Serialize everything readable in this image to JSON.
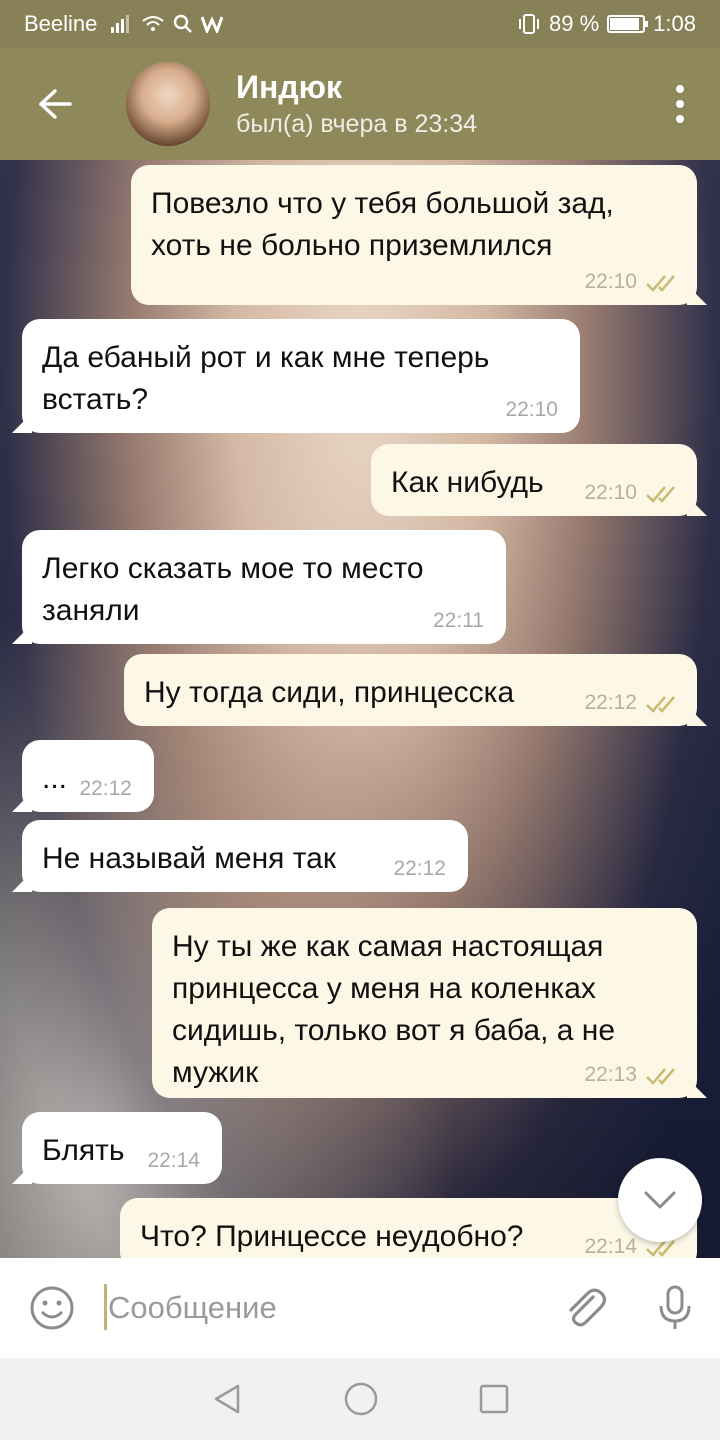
{
  "status": {
    "carrier": "Beeline",
    "battery": "89 %",
    "battery_level": 0.89,
    "time": "1:08"
  },
  "header": {
    "title": "Индюк",
    "subtitle": "был(а) вчера в 23:34"
  },
  "messages": [
    {
      "dir": "out",
      "text": "Повезло что у тебя большой зад, хоть не больно приземлился",
      "time": "22:10"
    },
    {
      "dir": "in",
      "text": "Да ебаный рот и как мне теперь встать?",
      "time": "22:10"
    },
    {
      "dir": "out",
      "text": "Как нибудь",
      "time": "22:10"
    },
    {
      "dir": "in",
      "text": "Легко сказать мое то место заняли",
      "time": "22:11"
    },
    {
      "dir": "out",
      "text": "Ну тогда сиди, принцесска",
      "time": "22:12"
    },
    {
      "dir": "in",
      "text": "...",
      "time": "22:12"
    },
    {
      "dir": "in",
      "text": "Не называй меня так",
      "time": "22:12"
    },
    {
      "dir": "out",
      "text": "Ну ты же как самая настоящая принцесса у меня на коленках сидишь, только вот я баба, а не мужик",
      "time": "22:13"
    },
    {
      "dir": "in",
      "text": "Блять",
      "time": "22:14"
    },
    {
      "dir": "out",
      "text": "Что? Принцессе неудобно?",
      "time": "22:14"
    }
  ],
  "composer": {
    "placeholder": "Сообщение"
  },
  "colors": {
    "header": "#8e885b",
    "outgoing_bubble": "#fdf8e6",
    "incoming_bubble": "#ffffff",
    "read_ticks": "#c9bb74"
  },
  "icons": [
    "back-arrow-icon",
    "more-vert-icon",
    "double-check-icon",
    "chevron-down-icon",
    "emoji-icon",
    "attach-icon",
    "mic-icon",
    "nav-back-icon",
    "nav-home-icon",
    "nav-recents-icon"
  ]
}
